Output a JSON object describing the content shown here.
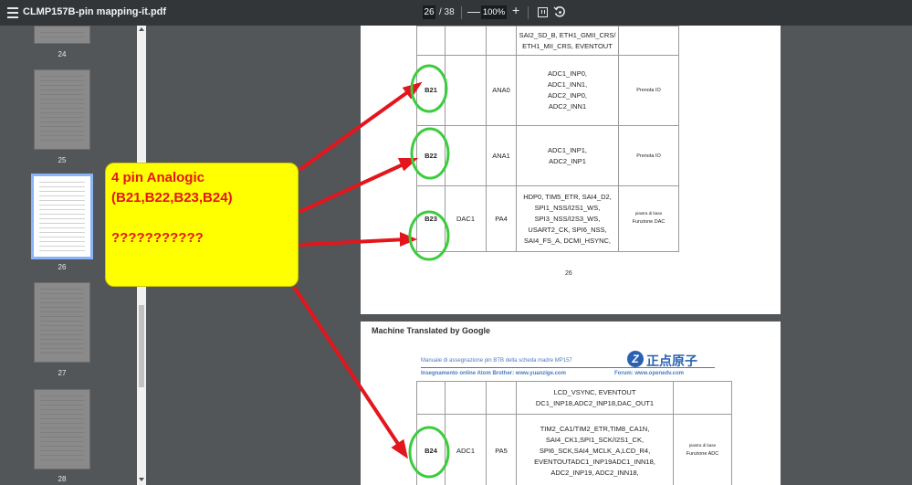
{
  "toolbar": {
    "title": "CLMP157B-pin mapping-it.pdf",
    "current_page": "26",
    "total_pages": "/ 38",
    "zoom": "100%",
    "zoom_out": "—",
    "zoom_in": "+"
  },
  "sidebar": {
    "pages": [
      "24",
      "25",
      "26",
      "27",
      "28"
    ],
    "active_page": "26"
  },
  "page1": {
    "rows": [
      {
        "pin": "",
        "signal": "",
        "port": "",
        "functions": [
          "SAI2_SD_B, ETH1_GMII_CRS/",
          "ETH1_MII_CRS, EVENTOUT"
        ],
        "note": ""
      },
      {
        "pin": "B21",
        "signal": "",
        "port": "ANA0",
        "functions": [
          "ADC1_INP0,",
          "ADC1_INN1,",
          "ADC2_INP0,",
          "ADC2_INN1"
        ],
        "note": "Prenota IO"
      },
      {
        "pin": "B22",
        "signal": "",
        "port": "ANA1",
        "functions": [
          "ADC1_INP1,",
          "ADC2_INP1"
        ],
        "note": "Prenota IO"
      },
      {
        "pin": "B23",
        "signal": "DAC1",
        "port": "PA4",
        "functions": [
          "HDP0, TIM5_ETR, SAI4_D2,",
          "SPI1_NSS/I2S1_WS,",
          "SPI3_NSS/I2S3_WS,",
          "USART2_CK, SPI6_NSS,",
          "SAI4_FS_A, DCMI_HSYNC,"
        ],
        "note_small": "piastra di base",
        "note": "Funzione DAC"
      }
    ],
    "page_number": "26"
  },
  "page2": {
    "machine_translated": "Machine Translated by Google",
    "header_left": "Manuale di assegnazione pin BTB della scheda madre MP157",
    "header_left2": "Insegnamento online Atom Brother: www.yuanzige.com",
    "header_right": "Forum: www.openedv.com",
    "logo": "正点原子",
    "logo_mark": "Z",
    "rows": [
      {
        "pin": "",
        "signal": "",
        "port": "",
        "functions": [
          "LCD_VSYNC, EVENTOUT",
          "DC1_INP18,ADC2_INP18,DAC_OUT1"
        ],
        "note": ""
      },
      {
        "pin": "B24",
        "signal": "ADC1",
        "port": "PA5",
        "functions": [
          "TIM2_CA1/TIM2_ETR,TIM8_CA1N,",
          "SAI4_CK1,SPI1_SCK/I2S1_CK,",
          "SPI6_SCK,SAI4_MCLK_A,LCD_R4,",
          "EVENTOUTADC1_INP19ADC1_INN18,",
          "ADC2_INP19, ADC2_INN18,"
        ],
        "note_small": "piastra di base",
        "note": "Funzione ADC"
      }
    ]
  },
  "annotation": {
    "line1": "4 pin Analogic",
    "line2": "(B21,B22,B23,B24)",
    "line3": "???????????",
    "text_color": "#e3161d",
    "box_color": "#ffff00",
    "arrow_color": "#e3161d",
    "circle_color": "#3dcc3d"
  }
}
